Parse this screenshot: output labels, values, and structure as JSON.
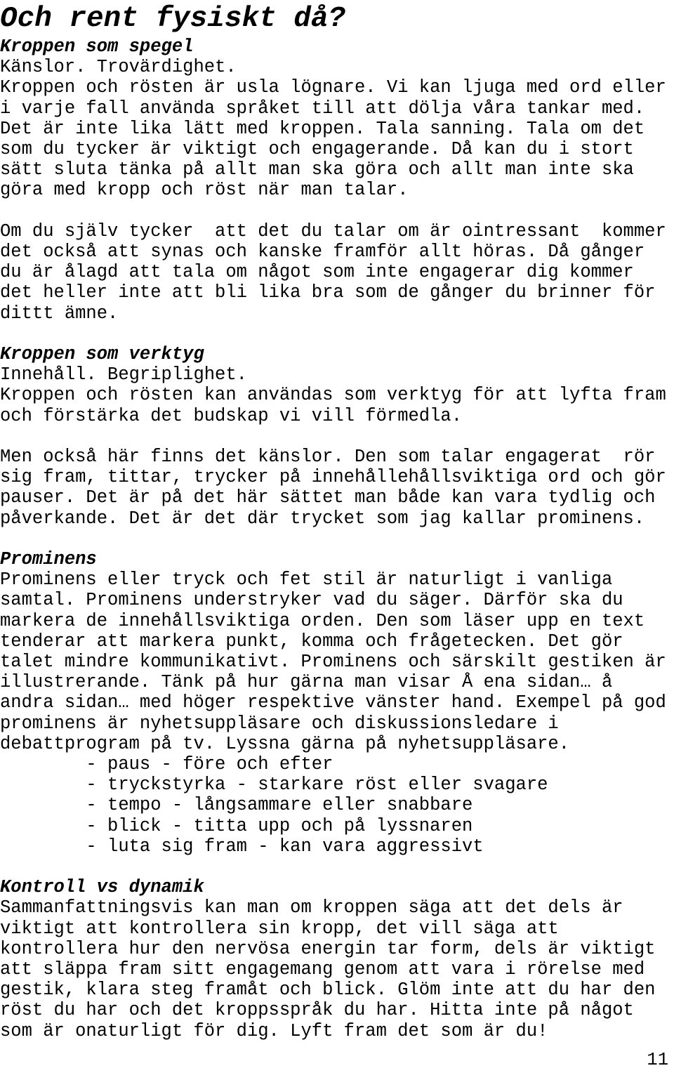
{
  "document": {
    "title": "Och rent fysiskt då?",
    "page_number": "11",
    "text_color": "#000000",
    "background_color": "#ffffff"
  },
  "sections": [
    {
      "heading": "Kroppen som spegel",
      "paragraphs": [
        {
          "lines": [
            "Känslor. Trovärdighet."
          ]
        },
        {
          "lines": [
            "Kroppen och rösten är usla lögnare. Vi kan ljuga med ord eller",
            "i varje fall använda språket till att dölja våra tankar med.",
            "Det är inte lika lätt med kroppen. Tala sanning. Tala om det",
            "som du tycker är viktigt och engagerande. Då kan du i stort",
            "sätt sluta tänka på allt man ska göra och allt man inte ska",
            "göra med kropp och röst när man talar."
          ]
        },
        {
          "lines": [
            "Om du själv tycker  att det du talar om är ointressant  kommer",
            "det också att synas och kanske framför allt höras. Då gånger",
            "du är ålagd att tala om något som inte engagerar dig kommer",
            "det heller inte att bli lika bra som de gånger du brinner för",
            "dittt ämne."
          ]
        }
      ]
    },
    {
      "heading": "Kroppen som verktyg",
      "paragraphs": [
        {
          "lines": [
            "Innehåll. Begriplighet.",
            "Kroppen och rösten kan användas som verktyg för att lyfta fram",
            "och förstärka det budskap vi vill förmedla."
          ]
        },
        {
          "lines": [
            "Men också här finns det känslor. Den som talar engagerat  rör",
            "sig fram, tittar, trycker på innehållehållsviktiga ord och gör",
            "pauser. Det är på det här sättet man både kan vara tydlig och",
            "påverkande. Det är det där trycket som jag kallar prominens."
          ]
        }
      ]
    },
    {
      "heading": "Prominens",
      "paragraphs": [
        {
          "lines": [
            "Prominens eller tryck och fet stil är naturligt i vanliga",
            "samtal. Prominens understryker vad du säger. Därför ska du",
            "markera de innehållsviktiga orden. Den som läser upp en text",
            "tenderar att markera punkt, komma och frågetecken. Det gör",
            "talet mindre kommunikativt. Prominens och särskilt gestiken är",
            "illustrerande. Tänk på hur gärna man visar Å ena sidan… å",
            "andra sidan… med höger respektive vänster hand. Exempel på god",
            "prominens är nyhetsuppläsare och diskussionsledare i",
            "debattprogram på tv. Lyssna gärna på nyhetsuppläsare."
          ]
        }
      ],
      "bullets": [
        "        - paus - före och efter",
        "        - tryckstyrka - starkare röst eller svagare",
        "        - tempo - långsammare eller snabbare",
        "        - blick - titta upp och på lyssnaren",
        "        - luta sig fram - kan vara aggressivt"
      ]
    },
    {
      "heading": "Kontroll vs dynamik",
      "paragraphs": [
        {
          "lines": [
            "Sammanfattningsvis kan man om kroppen säga att det dels är",
            "viktigt att kontrollera sin kropp, det vill säga att",
            "kontrollera hur den nervösa energin tar form, dels är viktigt",
            "att släppa fram sitt engagemang genom att vara i rörelse med",
            "gestik, klara steg framåt och blick. Glöm inte att du har den",
            "röst du har och det kroppsspråk du har. Hitta inte på något",
            "som är onaturligt för dig. Lyft fram det som är du!"
          ]
        }
      ]
    }
  ]
}
